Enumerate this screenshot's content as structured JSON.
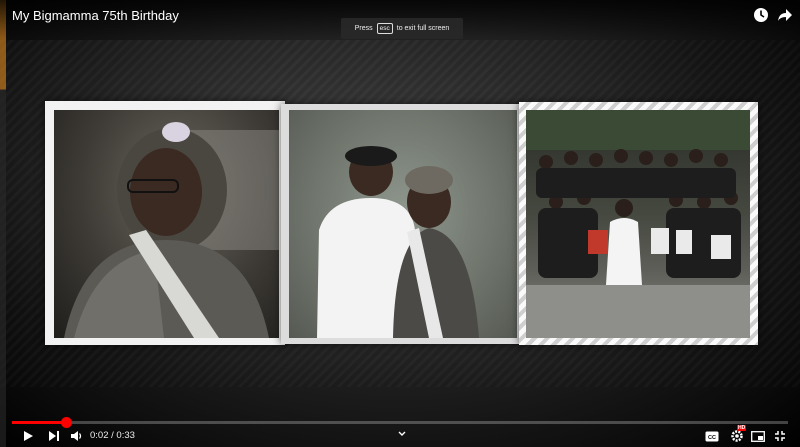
{
  "video": {
    "title": "My Bigmamma 75th Birthday",
    "esc_prefix": "Press",
    "esc_key": "esc",
    "esc_suffix": "to exit full screen"
  },
  "controls": {
    "time": "0:02 / 0:33",
    "progress_fraction": 0.07,
    "icons": [
      "play-icon",
      "next-icon",
      "volume-icon",
      "chevron-up-icon",
      "captions-icon",
      "settings-icon",
      "miniplayer-icon",
      "exit-fullscreen-icon"
    ],
    "hd_badge": "HD"
  },
  "colors": {
    "progress": "#ff0000",
    "background": "#000000",
    "frame": "#f2f2f2"
  }
}
